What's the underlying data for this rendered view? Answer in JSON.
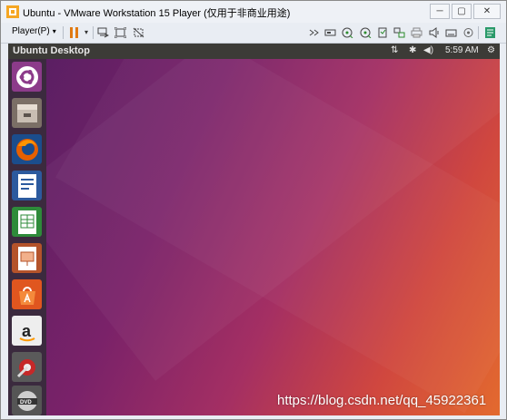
{
  "window": {
    "title": "Ubuntu - VMware Workstation 15 Player (仅用于非商业用途)",
    "controls": {
      "minimize": "─",
      "maximize": "▢",
      "close": "✕"
    }
  },
  "toolbar": {
    "player_menu_label": "Player(P)",
    "caret": "▾",
    "icons": [
      "pause-icon",
      "send-ctrl-alt-del-icon",
      "fit-guest-icon",
      "unity-mode-icon",
      "forward-icon",
      "removable-device-icon",
      "cd-drive-icon",
      "cd-drive-2-icon",
      "usb-icon",
      "network-icon",
      "printer-icon",
      "sound-icon",
      "hard-disk-icon",
      "display-icon",
      "message-log-icon"
    ]
  },
  "ubuntu": {
    "topbar_title": "Ubuntu Desktop",
    "tray": {
      "network": "⇅",
      "bluetooth": "✱",
      "volume": "◀)",
      "time": "5:59 AM",
      "settings": "⚙"
    },
    "launcher": [
      "ubuntu-icon",
      "files-icon",
      "firefox-icon",
      "writer-icon",
      "calc-icon",
      "impress-icon",
      "software-center-icon",
      "amazon-icon",
      "system-settings-icon",
      "dvd-icon"
    ]
  },
  "watermark": "https://blog.csdn.net/qq_45922361",
  "colors": {
    "accent_pause": "#e07a12",
    "topbar": "#3c3b37",
    "launcher": "#3b2a3e"
  }
}
